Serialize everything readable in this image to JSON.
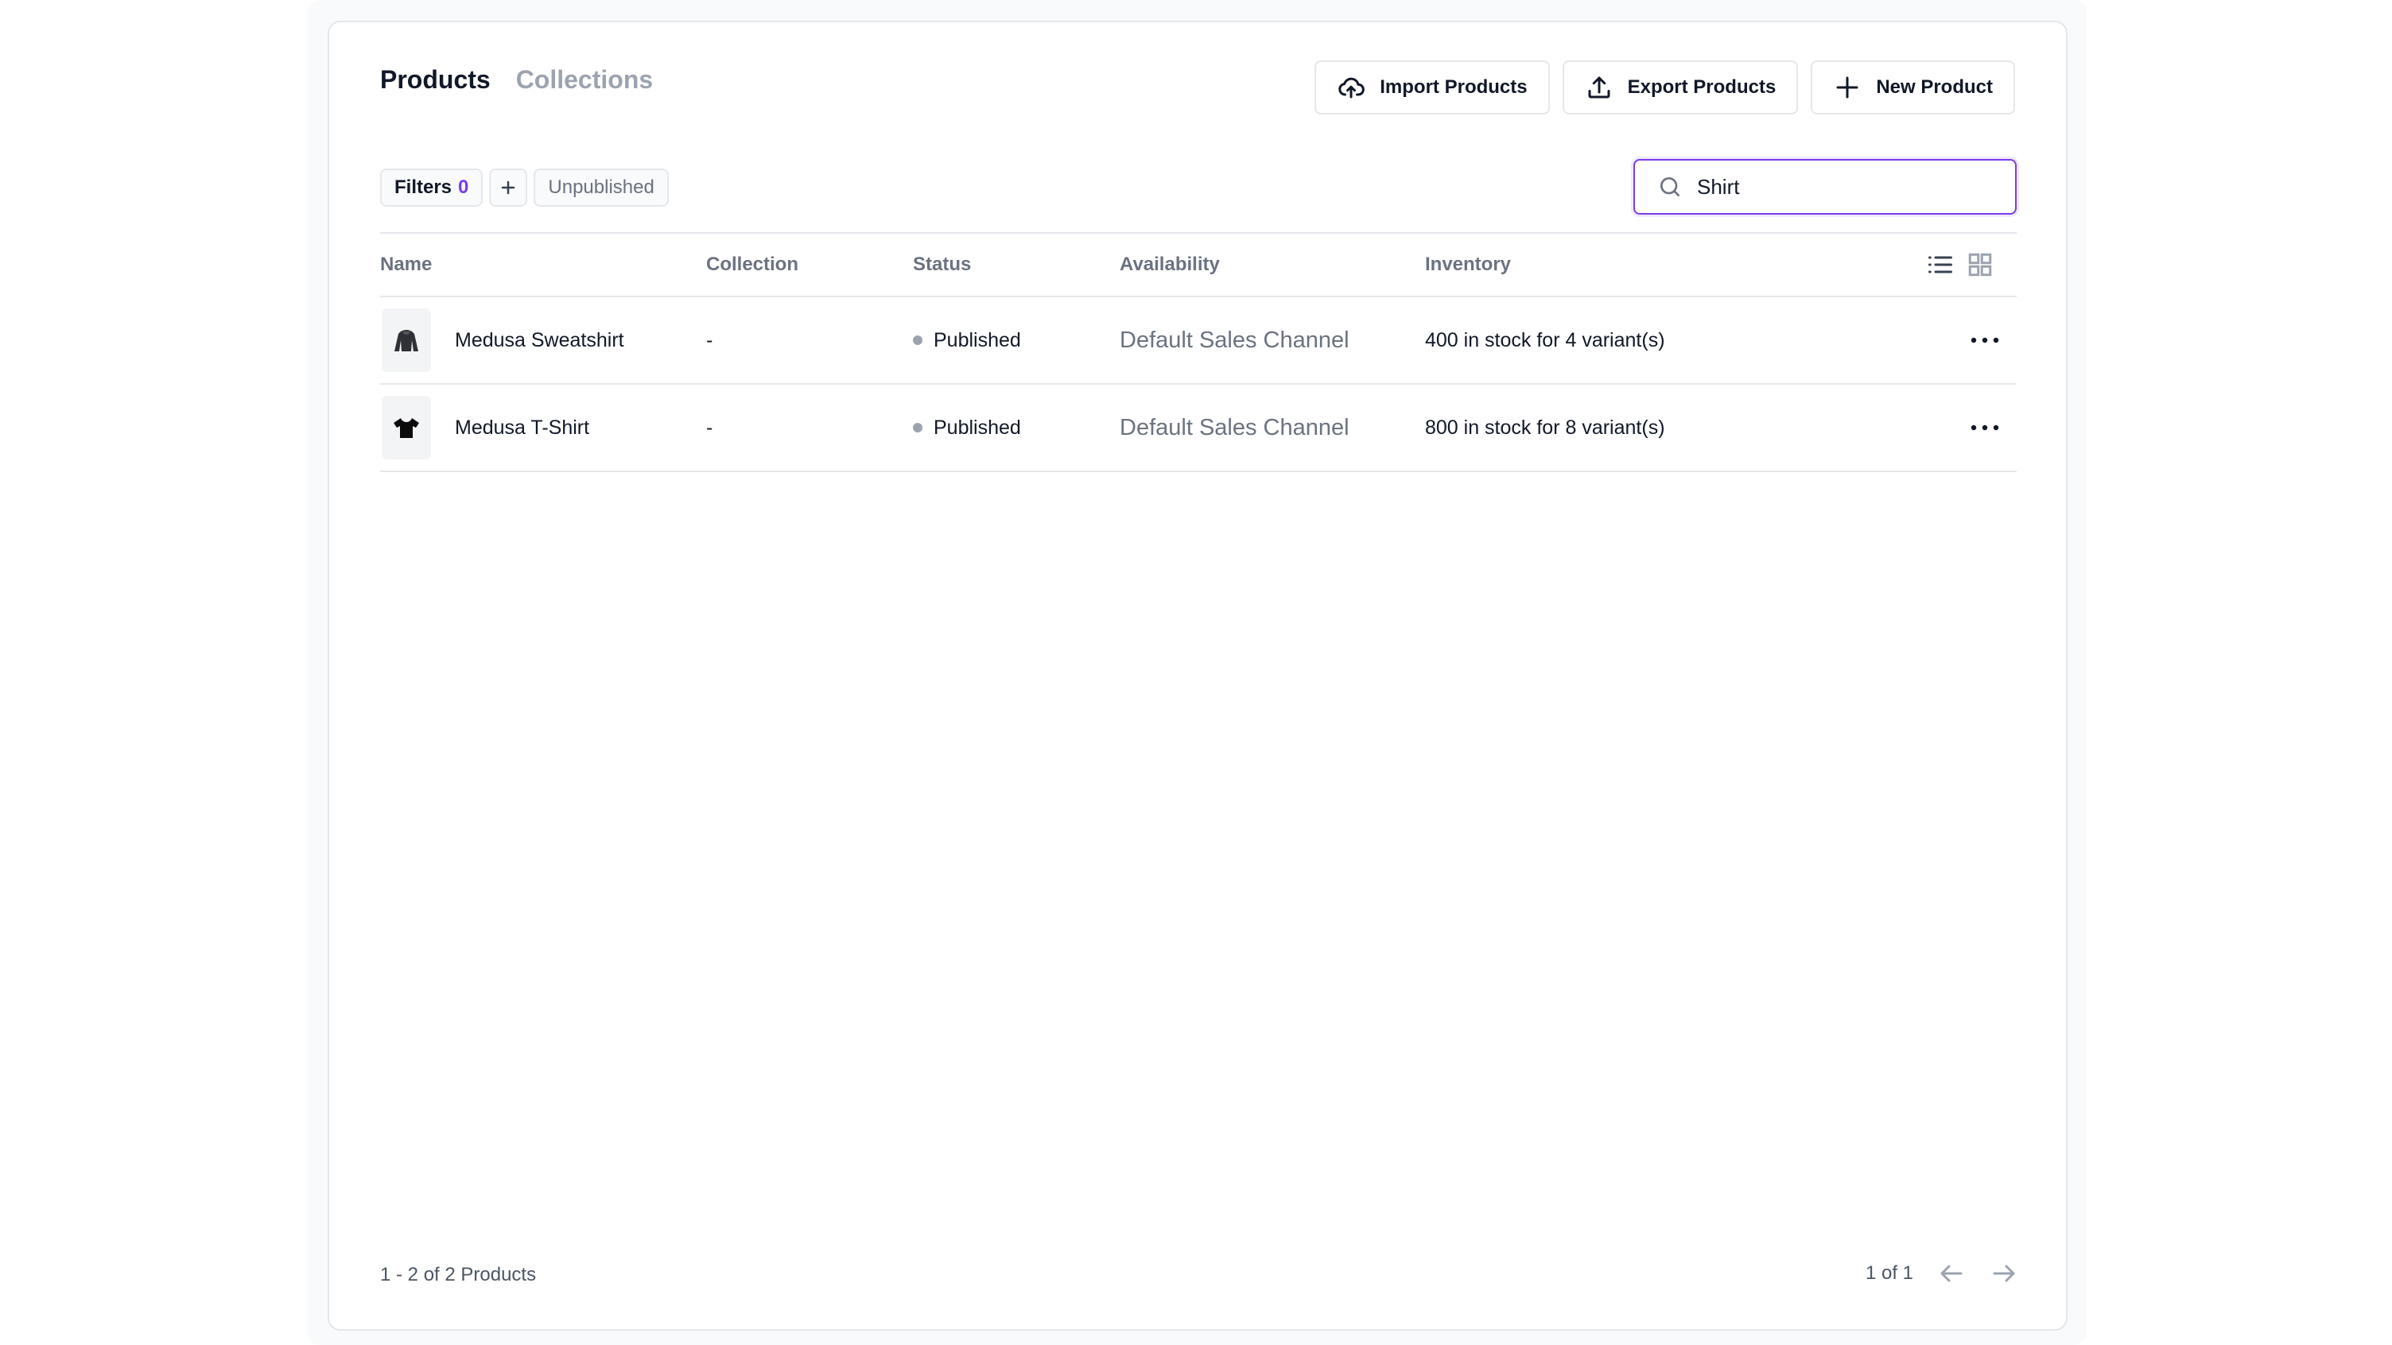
{
  "header": {
    "tabs": [
      {
        "label": "Products",
        "active": true
      },
      {
        "label": "Collections",
        "active": false
      }
    ],
    "actions": {
      "import_label": "Import Products",
      "export_label": "Export Products",
      "new_label": "New Product"
    }
  },
  "filters": {
    "label": "Filters",
    "count": "0",
    "add_icon": "plus-icon",
    "saved_filter": "Unpublished"
  },
  "search": {
    "value": "Shirt",
    "icon": "search-icon"
  },
  "table": {
    "columns": [
      "Name",
      "Collection",
      "Status",
      "Availability",
      "Inventory"
    ],
    "rows": [
      {
        "thumb_icon": "sweatshirt-icon",
        "name": "Medusa Sweatshirt",
        "collection": "-",
        "status": "Published",
        "availability": "Default Sales Channel",
        "inventory": "400 in stock for 4 variant(s)"
      },
      {
        "thumb_icon": "tshirt-icon",
        "name": "Medusa T-Shirt",
        "collection": "-",
        "status": "Published",
        "availability": "Default Sales Channel",
        "inventory": "800 in stock for 8 variant(s)"
      }
    ]
  },
  "footer": {
    "summary": "1 - 2 of 2 Products",
    "pagination": "1 of 1"
  },
  "colors": {
    "accent": "#7c3aed",
    "status_dot": "#9ca3af",
    "border": "#e5e7eb"
  }
}
